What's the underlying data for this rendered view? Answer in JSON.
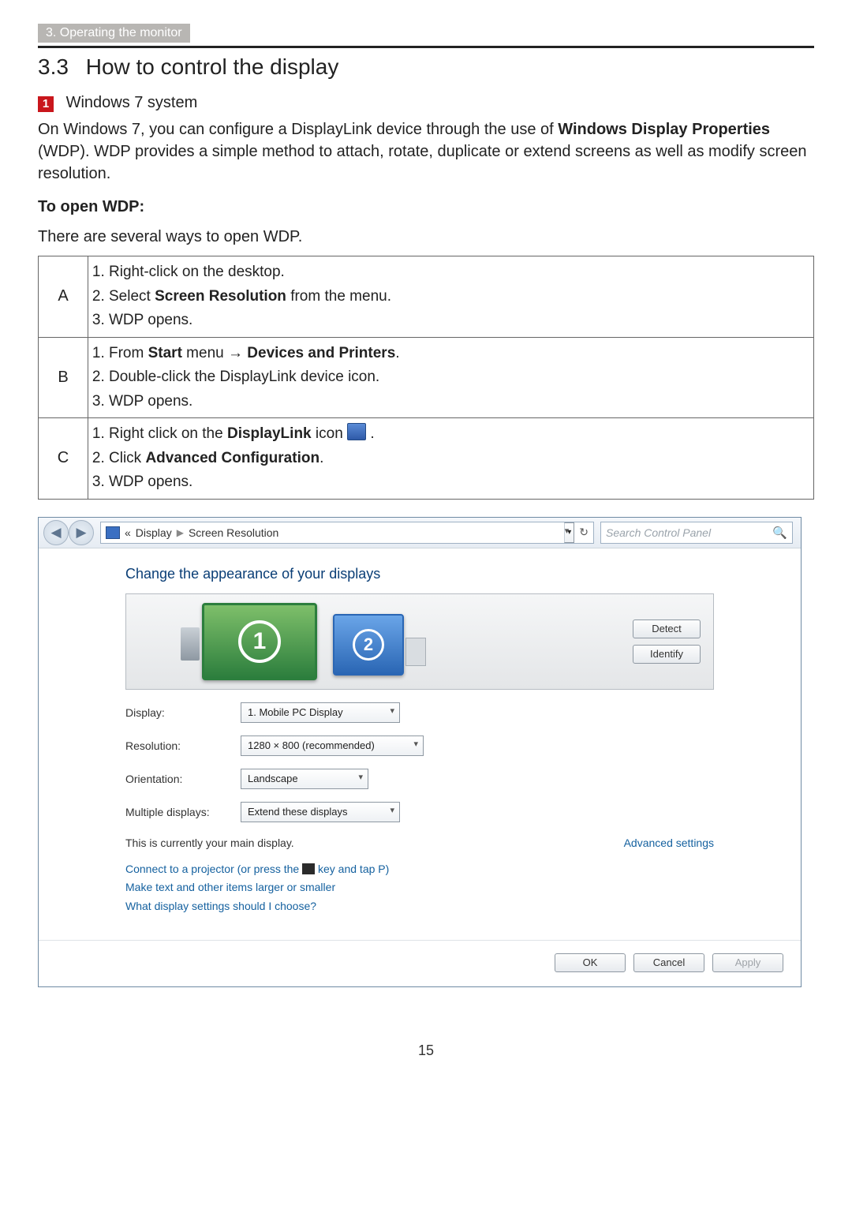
{
  "section_tab": "3. Operating the monitor",
  "heading": {
    "number": "3.3",
    "text": "How to control the display"
  },
  "bullet_num": "1",
  "sub_heading": "Windows 7 system",
  "intro_pre": "On Windows 7, you can configure a DisplayLink device through the use of ",
  "intro_bold": "Windows Display Properties",
  "intro_post": " (WDP). WDP provides a simple method to attach, rotate, duplicate or extend screens as well as modify screen resolution.",
  "open_h": "To open WDP:",
  "open_sub": "There are several ways to open WDP.",
  "ways": {
    "A": {
      "s1": "Right-click on the desktop.",
      "s2_pre": "Select ",
      "s2_bold": "Screen Resolution",
      "s2_post": " from the menu.",
      "s3": "WDP opens."
    },
    "B": {
      "s1_pre": "From ",
      "s1_b1": "Start",
      "s1_mid": " menu ",
      "s1_arrow": "→",
      "s1_b2": " Devices and Printers",
      "s1_post": ".",
      "s2": "Double-click the DisplayLink device icon.",
      "s3": "WDP opens."
    },
    "C": {
      "s1_pre": "Right click on the ",
      "s1_bold": "DisplayLink",
      "s1_post": " icon ",
      "s2_pre": "Click ",
      "s2_bold": "Advanced Configuration",
      "s2_post": ".",
      "s3": "WDP opens."
    }
  },
  "labels": {
    "A": "A",
    "B": "B",
    "C": "C"
  },
  "screenshot": {
    "breadcrumb": {
      "pre": "«",
      "seg1": "Display",
      "sep": "▶",
      "seg2": "Screen Resolution"
    },
    "search_placeholder": "Search Control Panel",
    "heading": "Change the appearance of your displays",
    "mon1": "1",
    "mon2": "2",
    "detect": "Detect",
    "identify": "Identify",
    "rows": {
      "display_lbl": "Display:",
      "display_val": "1. Mobile PC Display",
      "resolution_lbl": "Resolution:",
      "resolution_val": "1280 × 800 (recommended)",
      "orientation_lbl": "Orientation:",
      "orientation_val": "Landscape",
      "multiple_lbl": "Multiple displays:",
      "multiple_val": "Extend these displays"
    },
    "main_note": "This is currently your main display.",
    "advanced": "Advanced settings",
    "link1_pre": "Connect to a projector (or press the ",
    "link1_post": " key and tap P)",
    "link2": "Make text and other items larger or smaller",
    "link3": "What display settings should I choose?",
    "ok": "OK",
    "cancel": "Cancel",
    "apply": "Apply"
  },
  "page_number": "15",
  "chart_data": null
}
